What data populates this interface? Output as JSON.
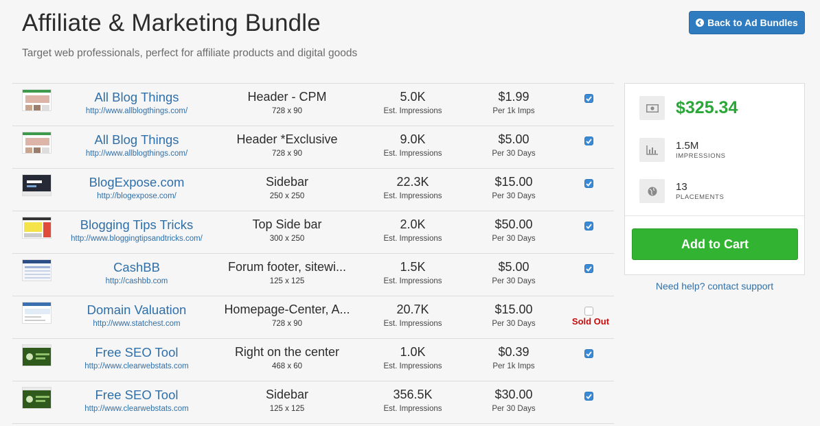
{
  "header": {
    "title": "Affiliate & Marketing Bundle",
    "subtitle": "Target web professionals, perfect for affiliate products and digital goods",
    "back_label": "Back to Ad Bundles"
  },
  "rows": [
    {
      "site": "All Blog Things",
      "url": "http://www.allblogthings.com/",
      "placement": "Header - CPM",
      "size": "728 x 90",
      "impressions": "5.0K",
      "impressions_label": "Est. Impressions",
      "price": "$1.99",
      "price_label": "Per 1k Imps",
      "checked": true,
      "sold_out": ""
    },
    {
      "site": "All Blog Things",
      "url": "http://www.allblogthings.com/",
      "placement": "Header *Exclusive",
      "size": "728 x 90",
      "impressions": "9.0K",
      "impressions_label": "Est. Impressions",
      "price": "$5.00",
      "price_label": "Per 30 Days",
      "checked": true,
      "sold_out": ""
    },
    {
      "site": "BlogExpose.com",
      "url": "http://blogexpose.com/",
      "placement": "Sidebar",
      "size": "250 x 250",
      "impressions": "22.3K",
      "impressions_label": "Est. Impressions",
      "price": "$15.00",
      "price_label": "Per 30 Days",
      "checked": true,
      "sold_out": ""
    },
    {
      "site": "Blogging Tips Tricks",
      "url": "http://www.bloggingtipsandtricks.com/",
      "placement": "Top Side bar",
      "size": "300 x 250",
      "impressions": "2.0K",
      "impressions_label": "Est. Impressions",
      "price": "$50.00",
      "price_label": "Per 30 Days",
      "checked": true,
      "sold_out": ""
    },
    {
      "site": "CashBB",
      "url": "http://cashbb.com",
      "placement": "Forum footer, sitewi...",
      "size": "125 x 125",
      "impressions": "1.5K",
      "impressions_label": "Est. Impressions",
      "price": "$5.00",
      "price_label": "Per 30 Days",
      "checked": true,
      "sold_out": ""
    },
    {
      "site": "Domain Valuation",
      "url": "http://www.statchest.com",
      "placement": "Homepage-Center, A...",
      "size": "728 x 90",
      "impressions": "20.7K",
      "impressions_label": "Est. Impressions",
      "price": "$15.00",
      "price_label": "Per 30 Days",
      "checked": false,
      "sold_out": "Sold Out"
    },
    {
      "site": "Free SEO Tool",
      "url": "http://www.clearwebstats.com",
      "placement": "Right on the center",
      "size": "468 x 60",
      "impressions": "1.0K",
      "impressions_label": "Est. Impressions",
      "price": "$0.39",
      "price_label": "Per 1k Imps",
      "checked": true,
      "sold_out": ""
    },
    {
      "site": "Free SEO Tool",
      "url": "http://www.clearwebstats.com",
      "placement": "Sidebar",
      "size": "125 x 125",
      "impressions": "356.5K",
      "impressions_label": "Est. Impressions",
      "price": "$30.00",
      "price_label": "Per 30 Days",
      "checked": true,
      "sold_out": ""
    }
  ],
  "summary": {
    "total": "$325.34",
    "impressions_value": "1.5M",
    "impressions_label": "IMPRESSIONS",
    "placements_value": "13",
    "placements_label": "PLACEMENTS",
    "cart_label": "Add to Cart",
    "help_label": "Need help? contact support"
  },
  "colors": {
    "accent": "#2f7bbf",
    "link": "#2f6fa9",
    "success": "#33b332",
    "price": "#29a838",
    "danger": "#c40d0d"
  },
  "icons": {
    "back": "arrow-circle-left-icon",
    "money": "money-icon",
    "chart": "bar-chart-icon",
    "globe": "globe-icon",
    "check": "checkbox-icon"
  }
}
